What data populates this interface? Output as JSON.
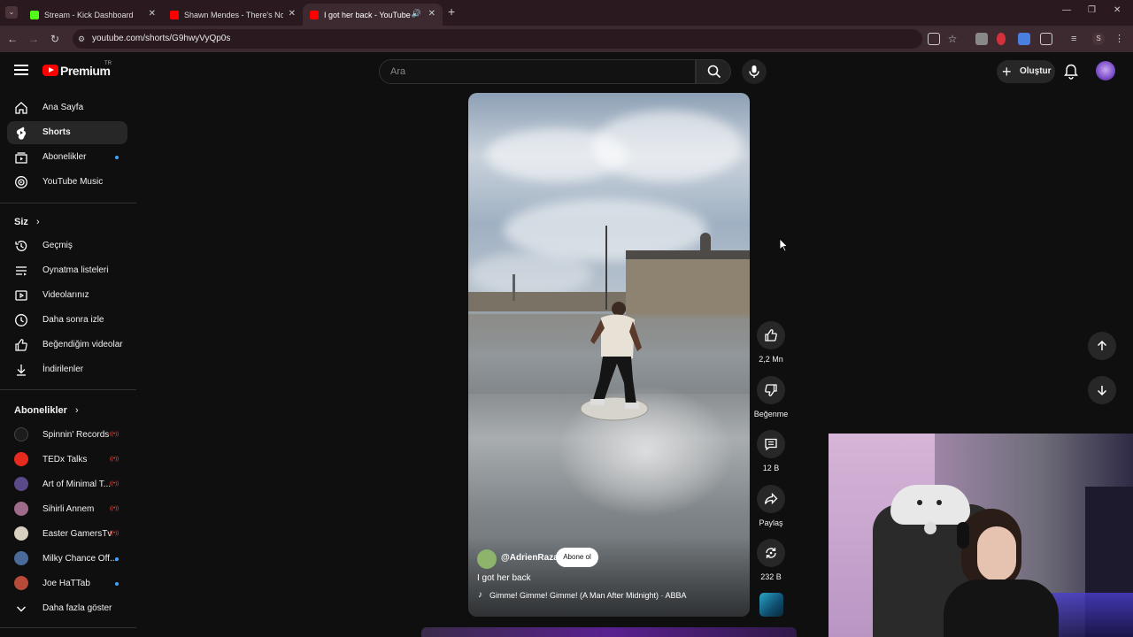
{
  "browser": {
    "tabs": [
      {
        "title": "Stream - Kick Dashboard",
        "favicon_color": "#53fc18"
      },
      {
        "title": "Shawn Mendes - There's Nothi",
        "favicon_color": "#ff0000"
      },
      {
        "title": "I got her back - YouTube",
        "favicon_color": "#ff0000"
      }
    ],
    "url": "youtube.com/shorts/G9hwyVyQp0s",
    "profile_initial": "S"
  },
  "header": {
    "logo_text": "Premium",
    "logo_region": "TR",
    "search_placeholder": "Ara",
    "create_label": "Oluştur"
  },
  "sidebar": {
    "main": [
      {
        "label": "Ana Sayfa",
        "icon": "home-icon"
      },
      {
        "label": "Shorts",
        "icon": "shorts-icon"
      },
      {
        "label": "Abonelikler",
        "icon": "subscriptions-icon"
      },
      {
        "label": "YouTube Music",
        "icon": "music-icon"
      }
    ],
    "you_heading": "Siz",
    "you": [
      {
        "label": "Geçmiş",
        "icon": "history-icon"
      },
      {
        "label": "Oynatma listeleri",
        "icon": "playlist-icon"
      },
      {
        "label": "Videolarınız",
        "icon": "video-icon"
      },
      {
        "label": "Daha sonra izle",
        "icon": "clock-icon"
      },
      {
        "label": "Beğendiğim videolar",
        "icon": "like-icon"
      },
      {
        "label": "İndirilenler",
        "icon": "download-icon"
      }
    ],
    "subs_heading": "Abonelikler",
    "subscriptions": [
      {
        "label": "Spinnin' Records",
        "color": "#1c1c1c",
        "status": "live"
      },
      {
        "label": "TEDx Talks",
        "color": "#e62b1e",
        "status": "live"
      },
      {
        "label": "Art of Minimal T...",
        "color": "#5b4a8a",
        "status": "live"
      },
      {
        "label": "Sihirli Annem",
        "color": "#a06a8a",
        "status": "live"
      },
      {
        "label": "Easter GamersTv",
        "color": "#d8d0c0",
        "status": "live"
      },
      {
        "label": "Milky Chance Off...",
        "color": "#4a6a9a",
        "status": "dot"
      },
      {
        "label": "Joe HaTTab",
        "color": "#b84a3a",
        "status": "dot"
      }
    ],
    "show_more": "Daha fazla göster"
  },
  "video": {
    "channel": "@AdrienRaza",
    "subscribe_label": "Abone ol",
    "title": "I got her back",
    "music": "Gimme! Gimme! Gimme! (A Man After Midnight) · ABBA"
  },
  "actions": {
    "likes": "2,2 Mn",
    "dislike_label": "Beğenme",
    "comments": "12 B",
    "share_label": "Paylaş",
    "remix": "232 B"
  }
}
